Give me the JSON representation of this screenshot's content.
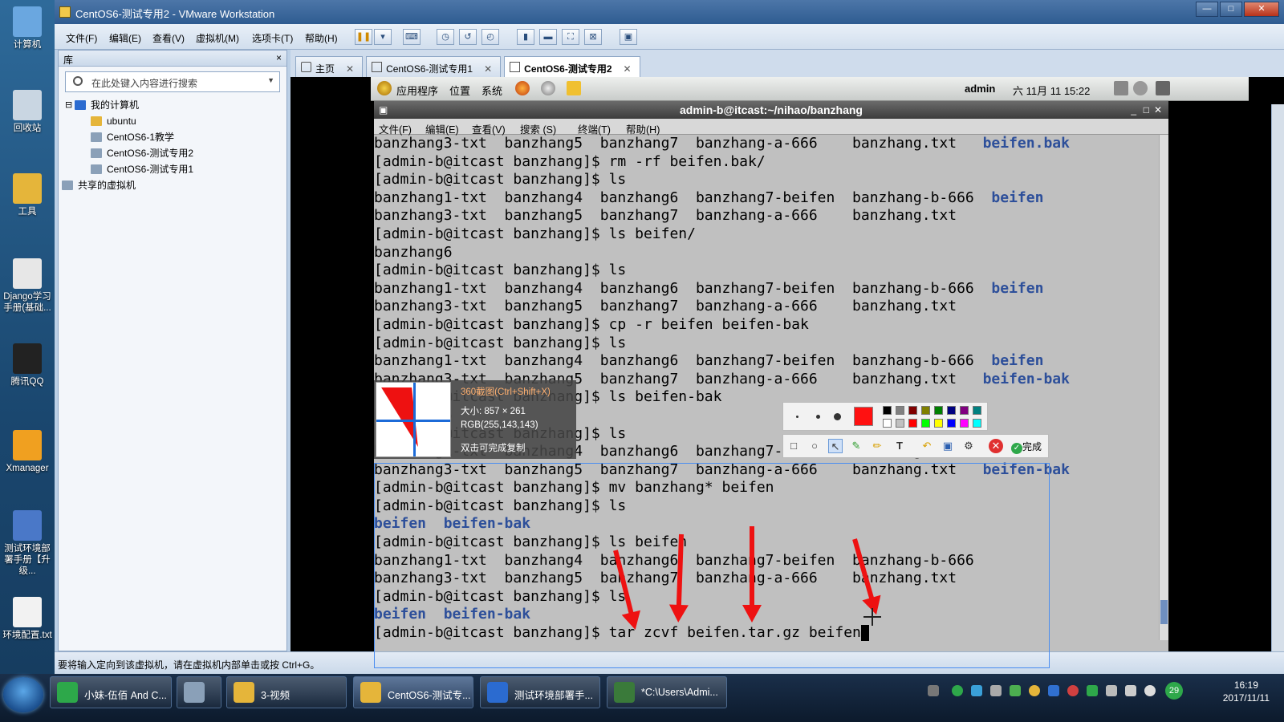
{
  "desktop_icons": [
    {
      "label": "计算机",
      "color": "#6aa7e0"
    },
    {
      "label": "回收站",
      "color": "#c9d6e2"
    },
    {
      "label": "工具",
      "color": "#e5b53a"
    },
    {
      "label": "Django学习手册(基础...",
      "color": "#e7e7e7"
    },
    {
      "label": "腾讯QQ",
      "color": "#222"
    },
    {
      "label": "Xmanager",
      "color": "#f0a020"
    },
    {
      "label": "测试环境部署手册【升级...",
      "color": "#4a78c8"
    },
    {
      "label": "环境配置.txt",
      "color": "#f2f2f2"
    }
  ],
  "window": {
    "title": "CentOS6-测试专用2 - VMware Workstation"
  },
  "menu": [
    "文件(F)",
    "编辑(E)",
    "查看(V)",
    "虚拟机(M)",
    "选项卡(T)",
    "帮助(H)"
  ],
  "library": {
    "header": "库",
    "close": "×",
    "search_placeholder": "在此处键入内容进行搜索",
    "tree": [
      {
        "label": "我的计算机",
        "level": 0,
        "expander": "⊟"
      },
      {
        "label": "ubuntu",
        "level": 1
      },
      {
        "label": "CentOS6-1教学",
        "level": 1
      },
      {
        "label": "CentOS6-测试专用2",
        "level": 1
      },
      {
        "label": "CentOS6-测试专用1",
        "level": 1
      },
      {
        "label": "共享的虚拟机",
        "level": 0
      }
    ]
  },
  "tabs": [
    {
      "label": "主页",
      "active": false
    },
    {
      "label": "CentOS6-测试专用1",
      "active": false
    },
    {
      "label": "CentOS6-测试专用2",
      "active": true
    }
  ],
  "guest_panel": {
    "apps": "应用程序",
    "places": "位置",
    "system": "系统",
    "user": "admin",
    "datetime": "六 11月 11 15:22"
  },
  "terminal": {
    "title": "admin-b@itcast:~/nihao/banzhang",
    "menu": [
      "文件(F)",
      "编辑(E)",
      "查看(V)",
      "搜索 (S)",
      "终端(T)",
      "帮助(H)"
    ],
    "lines": [
      {
        "text": "banzhang3-txt  banzhang5  banzhang7  banzhang-a-666    banzhang.txt",
        "dirs": "   beifen.bak"
      },
      {
        "text": "[admin-b@itcast banzhang]$ rm -rf beifen.bak/",
        "dirs": ""
      },
      {
        "text": "[admin-b@itcast banzhang]$ ls",
        "dirs": ""
      },
      {
        "text": "banzhang1-txt  banzhang4  banzhang6  banzhang7-beifen  banzhang-b-666",
        "dirs": "  beifen"
      },
      {
        "text": "banzhang3-txt  banzhang5  banzhang7  banzhang-a-666    banzhang.txt",
        "dirs": ""
      },
      {
        "text": "[admin-b@itcast banzhang]$ ls beifen/",
        "dirs": ""
      },
      {
        "text": "banzhang6",
        "dirs": ""
      },
      {
        "text": "[admin-b@itcast banzhang]$ ls",
        "dirs": ""
      },
      {
        "text": "banzhang1-txt  banzhang4  banzhang6  banzhang7-beifen  banzhang-b-666",
        "dirs": "  beifen"
      },
      {
        "text": "banzhang3-txt  banzhang5  banzhang7  banzhang-a-666    banzhang.txt",
        "dirs": ""
      },
      {
        "text": "[admin-b@itcast banzhang]$ cp -r beifen beifen-bak",
        "dirs": ""
      },
      {
        "text": "[admin-b@itcast banzhang]$ ls",
        "dirs": ""
      },
      {
        "text": "banzhang1-txt  banzhang4  banzhang6  banzhang7-beifen  banzhang-b-666",
        "dirs": "  beifen"
      },
      {
        "text": "banzhang3-txt  banzhang5  banzhang7  banzhang-a-666    banzhang.txt",
        "dirs": "   beifen-bak"
      },
      {
        "text": "[admin-b@itcast banzhang]$ ls beifen-bak",
        "dirs": ""
      },
      {
        "text": "banzhang6",
        "dirs": ""
      },
      {
        "text": "[admin-b@itcast banzhang]$ ls",
        "dirs": ""
      },
      {
        "text": "banzhang1-txt  banzhang4  banzhang6  banzhang7-beifen  banzhang-b-666",
        "dirs": "  beifen"
      },
      {
        "text": "banzhang3-txt  banzhang5  banzhang7  banzhang-a-666    banzhang.txt",
        "dirs": "   beifen-bak"
      },
      {
        "text": "[admin-b@itcast banzhang]$ mv banzhang* beifen",
        "dirs": ""
      },
      {
        "text": "[admin-b@itcast banzhang]$ ls",
        "dirs": ""
      },
      {
        "text": "",
        "dirs": "beifen  beifen-bak"
      },
      {
        "text": "[admin-b@itcast banzhang]$ ls beifen",
        "dirs": ""
      },
      {
        "text": "banzhang1-txt  banzhang4  banzhang6  banzhang7-beifen  banzhang-b-666",
        "dirs": ""
      },
      {
        "text": "banzhang3-txt  banzhang5  banzhang7  banzhang-a-666    banzhang.txt",
        "dirs": ""
      },
      {
        "text": "[admin-b@itcast banzhang]$ ls",
        "dirs": ""
      },
      {
        "text": "",
        "dirs": "beifen  beifen-bak"
      },
      {
        "text": "[admin-b@itcast banzhang]$ tar zcvf beifen.tar.gz beifen",
        "dirs": "",
        "cursor": true
      }
    ]
  },
  "screenshot_tool": {
    "title": "360截图(Ctrl+Shift+X)",
    "size": "大小: 857 × 261",
    "rgb": "RGB(255,143,143)",
    "hint": "双击可完成复制",
    "done": "完成",
    "colors": [
      "#000000",
      "#808080",
      "#800000",
      "#808000",
      "#008000",
      "#000080",
      "#800080",
      "#008080",
      "#ffffff",
      "#c0c0c0",
      "#ff0000",
      "#00ff00",
      "#ffff00",
      "#0000ff",
      "#ff00ff",
      "#00ffff"
    ],
    "selected_color": "#ff1111"
  },
  "status_bar": {
    "text": "要将输入定向到该虚拟机，请在虚拟机内部单击或按 Ctrl+G。"
  },
  "taskbar": {
    "tasks": [
      {
        "label": "小妹-伍佰 And C...",
        "color": "#2da84a"
      },
      {
        "label": "",
        "color": "#8aa0b8"
      },
      {
        "label": "3-视频",
        "color": "#e5b53a"
      },
      {
        "label": "CentOS6-测试专...",
        "color": "#e5b53a"
      },
      {
        "label": "测试环境部署手...",
        "color": "#2b6bd0"
      },
      {
        "label": "*C:\\Users\\Admi...",
        "color": "#3a7a3a"
      }
    ],
    "time": "16:19",
    "date": "2017/11/11",
    "badge": "29"
  }
}
